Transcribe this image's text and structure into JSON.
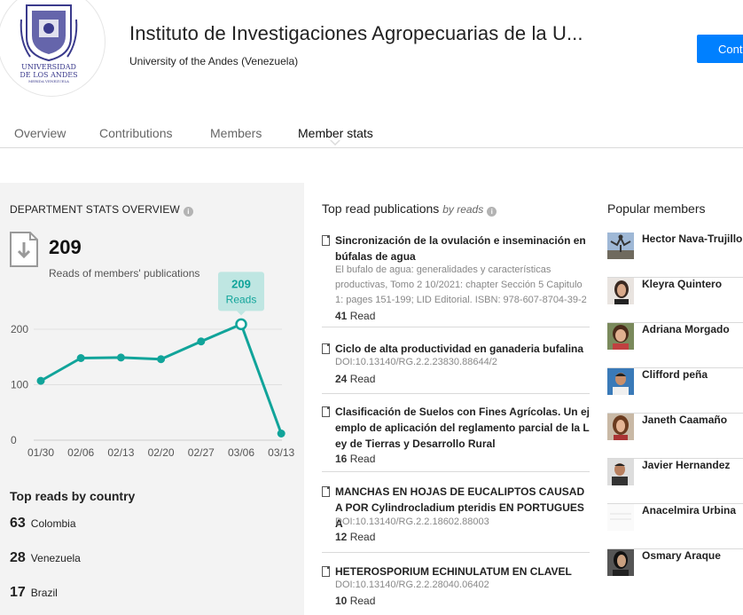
{
  "header": {
    "org_name": "Instituto de Investigaciones Agropecuarias de la U...",
    "org_parent": "University of the Andes (Venezuela)",
    "follow_label": "Cont",
    "logo_text": [
      "UNIVERSIDAD",
      "DE LOS ANDES",
      "MERIDA VENEZUELA"
    ]
  },
  "tabs": [
    {
      "label": "Overview"
    },
    {
      "label": "Contributions"
    },
    {
      "label": "Members"
    },
    {
      "label": "Member stats",
      "active": true
    }
  ],
  "stats": {
    "heading": "DEPARTMENT STATS OVERVIEW",
    "total_reads": "209",
    "total_reads_label": "Reads of members' publications",
    "tooltip_value": "209",
    "tooltip_label": "Reads"
  },
  "chart_data": {
    "type": "line",
    "categories": [
      "01/30",
      "02/06",
      "02/13",
      "02/20",
      "02/27",
      "03/06",
      "03/13"
    ],
    "values": [
      107,
      148,
      149,
      146,
      178,
      209,
      12
    ],
    "ylim": [
      0,
      200
    ],
    "yticks": [
      0,
      100,
      200
    ],
    "highlight_index": 5,
    "color": "#11a49a"
  },
  "countries": {
    "heading": "Top reads by country",
    "rows": [
      {
        "count": "63",
        "name": "Colombia"
      },
      {
        "count": "28",
        "name": "Venezuela"
      },
      {
        "count": "17",
        "name": "Brazil"
      }
    ]
  },
  "publications": {
    "heading": "Top read publications",
    "sub": "by reads",
    "items": [
      {
        "title": "Sincronización de la ovulación e inseminación en búfalas de agua",
        "meta": "El bufalo de agua: generalidades y características productivas, Tomo 2 10/2021: chapter Sección 5 Capitulo 1: pages 151-199; LID Editorial. ISBN: 978-607-8704-39-2",
        "reads": "41",
        "reads_label": "Read"
      },
      {
        "title": "Ciclo de alta productividad en ganaderia bufalina",
        "meta": "DOI:10.13140/RG.2.2.23830.88644/2",
        "reads": "24",
        "reads_label": "Read"
      },
      {
        "title": "Clasificación de Suelos con Fines Agrícolas. Un ejemplo de aplicación del reglamento parcial de la Ley de Tierras y Desarrollo Rural",
        "meta": "",
        "reads": "16",
        "reads_label": "Read"
      },
      {
        "title": "MANCHAS EN HOJAS DE EUCALIPTOS CAUSADA POR Cylindrocladium pteridis EN PORTUGUESA",
        "meta": "DOI:10.13140/RG.2.2.18602.88003",
        "reads": "12",
        "reads_label": "Read"
      },
      {
        "title": "HETEROSPORIUM ECHINULATUM EN CLAVEL",
        "meta": "DOI:10.13140/RG.2.2.28040.06402",
        "reads": "10",
        "reads_label": "Read"
      }
    ]
  },
  "members": {
    "heading": "Popular members",
    "items": [
      {
        "name": "Hector Nava-Trujillo"
      },
      {
        "name": "Kleyra Quintero"
      },
      {
        "name": "Adriana Morgado"
      },
      {
        "name": "Clifford peña"
      },
      {
        "name": "Janeth Caamaño"
      },
      {
        "name": "Javier Hernandez"
      },
      {
        "name": "Anacelmira Urbina"
      },
      {
        "name": "Osmary Araque"
      }
    ]
  }
}
